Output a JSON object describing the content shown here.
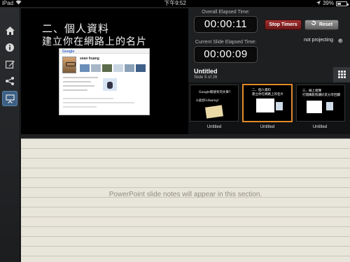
{
  "status_bar": {
    "device": "iPad",
    "time": "下午9:52",
    "battery": "39%"
  },
  "sidebar": {
    "items": [
      {
        "name": "home",
        "icon": "home-icon"
      },
      {
        "name": "info",
        "icon": "info-icon"
      },
      {
        "name": "edit",
        "icon": "edit-icon"
      },
      {
        "name": "share",
        "icon": "share-icon"
      },
      {
        "name": "presenter",
        "icon": "presenter-icon",
        "active": true
      }
    ]
  },
  "current_slide": {
    "title_line1": "二、個人資料",
    "title_line2": "建立你在網路上的名片",
    "screenshot_name": "sean huang"
  },
  "timers": {
    "overall_label": "Overall Elapsed Time:",
    "overall_value": "00:00:11",
    "current_label": "Current Slide Elapsed Time:",
    "current_value": "00:00:09",
    "stop_label": "Stop Timers",
    "reset_label": "Reset",
    "projecting_label": "not projecting"
  },
  "deck": {
    "title": "Untitled",
    "subtitle": "Slide 5 of 26"
  },
  "thumbnails": [
    {
      "label": "Untitled",
      "line1": "Google帳號有何文章？",
      "line2": "什麼是Following？"
    },
    {
      "label": "Untitled",
      "line1": "二、個人資料",
      "line2": "建立你在網路上的名片",
      "selected": true
    },
    {
      "label": "Untitled",
      "line1": "三、線上相簿",
      "line2": "打開攝影照讓好友分享回饋"
    }
  ],
  "notes": {
    "placeholder": "PowerPoint slide notes will appear in this section."
  },
  "colors": {
    "accent": "#e08a2a",
    "stop": "#a43232",
    "active_nav": "#3c5f83"
  }
}
